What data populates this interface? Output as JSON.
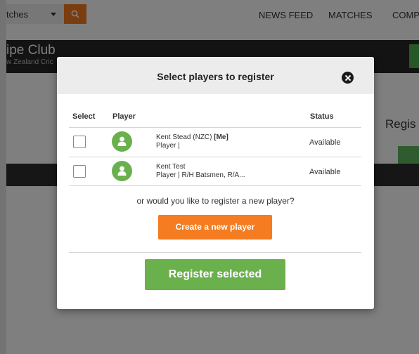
{
  "topbar": {
    "search_text": "tches",
    "nav": [
      "NEWS FEED",
      "MATCHES",
      "COMP"
    ]
  },
  "club": {
    "name": "ipe Club",
    "subtitle": "w Zealand Cric"
  },
  "background": {
    "register_partial": "Regis",
    "green_btn_partial": "R"
  },
  "modal": {
    "title": "Select players to register",
    "columns": {
      "select": "Select",
      "player": "Player",
      "status": "Status"
    },
    "rows": [
      {
        "name": "Kent Stead (NZC)",
        "me": "[Me]",
        "desc": "Player |",
        "status": "Available",
        "checked": false
      },
      {
        "name": "Kent Test",
        "me": "",
        "desc": "Player | R/H Batsmen, R/A...",
        "status": "Available",
        "checked": false
      }
    ],
    "question": "or would you like to register a new player?",
    "create_label": "Create a new player",
    "register_label": "Register selected"
  },
  "colors": {
    "accent_orange": "#f57c20",
    "accent_green": "#6ab04c",
    "header_bg": "#ececec"
  },
  "icons": {
    "search": "search-icon",
    "close": "close-icon",
    "avatar": "user-icon"
  }
}
